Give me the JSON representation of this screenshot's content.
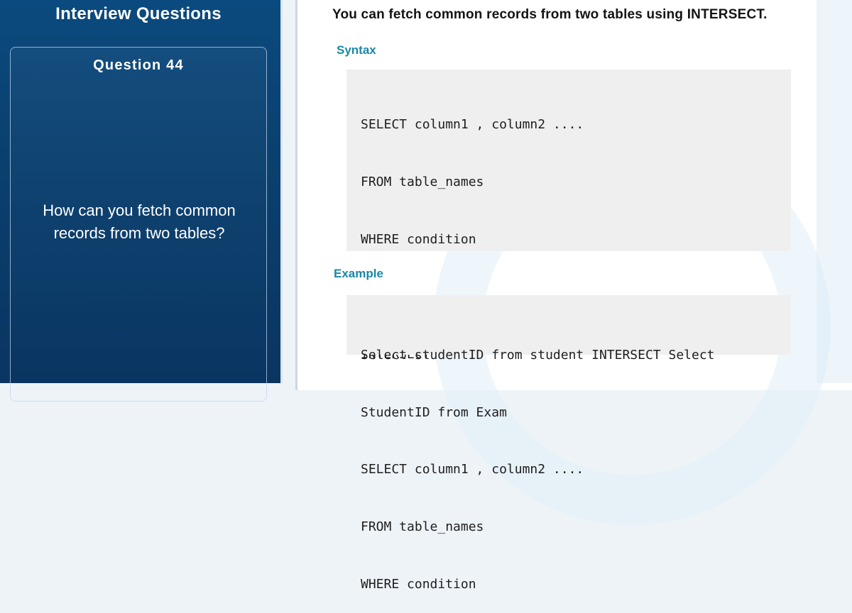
{
  "left_panel": {
    "title": "Interview Questions",
    "question_number": "Question 44",
    "question_text": "How can you fetch common records from two tables?"
  },
  "content": {
    "headline": "You can fetch common records from two tables using INTERSECT.",
    "syntax_label": "Syntax",
    "syntax_lines": [
      "SELECT column1 , column2 ....",
      "FROM table_names",
      "WHERE condition",
      "",
      "INTERSECT",
      "",
      "SELECT column1 , column2 ....",
      "FROM table_names",
      "WHERE condition"
    ],
    "example_label": "Example",
    "example_lines": [
      "Select studentID from student INTERSECT Select",
      "StudentID from Exam"
    ]
  },
  "colors": {
    "panel_blue": "#0a3f6e",
    "label_teal": "#1b87a6",
    "code_background": "#efefef"
  }
}
